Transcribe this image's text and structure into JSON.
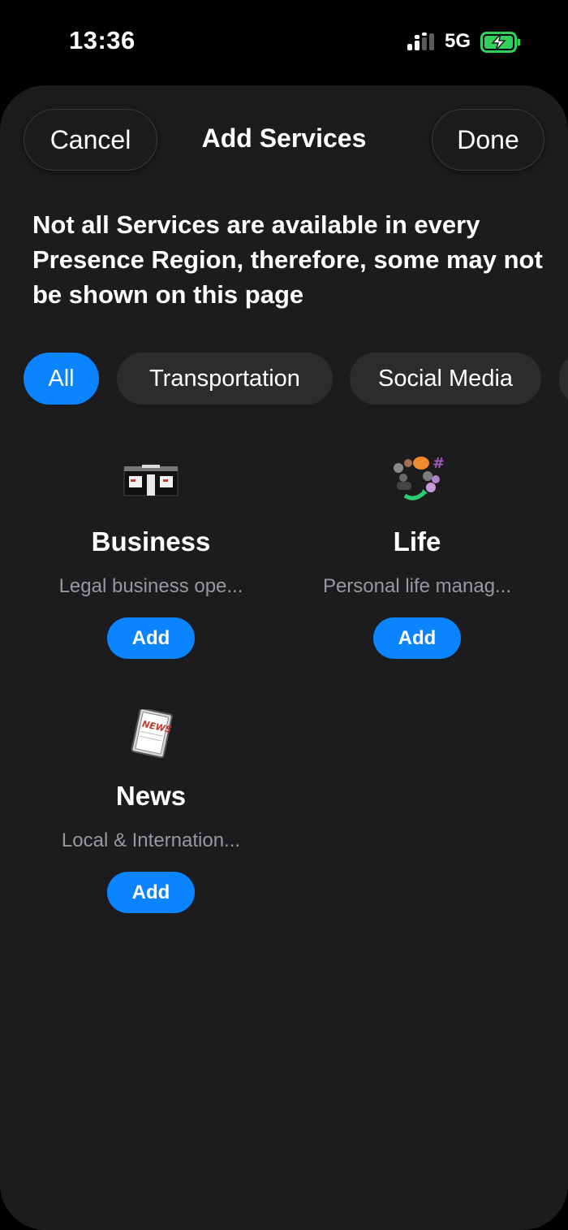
{
  "status_bar": {
    "time": "13:36",
    "network": "5G"
  },
  "header": {
    "cancel_label": "Cancel",
    "title": "Add Services",
    "done_label": "Done"
  },
  "notice": "Not all Services are available in every Presence Region, therefore, some may not be shown on this page",
  "filters": [
    {
      "label": "All",
      "selected": true
    },
    {
      "label": "Transportation",
      "selected": false
    },
    {
      "label": "Social Media",
      "selected": false
    }
  ],
  "services": [
    {
      "name": "Business",
      "description": "Legal business ope...",
      "add_label": "Add",
      "icon": "storefront-icon"
    },
    {
      "name": "Life",
      "description": "Personal life manag...",
      "add_label": "Add",
      "icon": "social-people-icon"
    },
    {
      "name": "News",
      "description": "Local & Internation...",
      "add_label": "Add",
      "icon": "newspaper-icon"
    }
  ],
  "colors": {
    "accent": "#0a84ff",
    "sheet_background": "#1c1c1e",
    "chip_background": "#2c2c2e",
    "secondary_text": "#98989d",
    "battery": "#30d158"
  }
}
